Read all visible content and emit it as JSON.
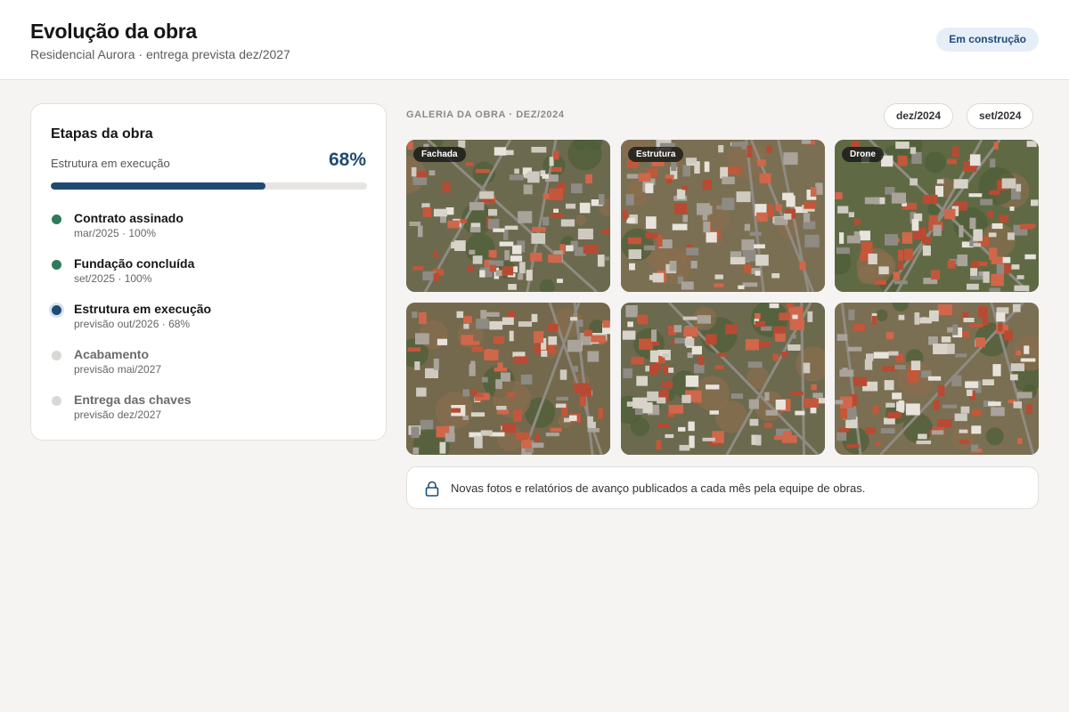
{
  "header": {
    "title": "Evolução da obra",
    "subtitle": "Residencial Aurora · entrega prevista dez/2027",
    "status": "Em construção"
  },
  "progress_card": {
    "title": "Etapas da obra",
    "current_stage": "Estrutura em execução",
    "percent_label": "68%",
    "progress": 0.68,
    "stages": [
      {
        "name": "Contrato assinado",
        "meta": "mar/2025 · 100%",
        "state": "done"
      },
      {
        "name": "Fundação concluída",
        "meta": "set/2025 · 100%",
        "state": "done"
      },
      {
        "name": "Estrutura em execução",
        "meta": "previsão out/2026 · 68%",
        "state": "current"
      },
      {
        "name": "Acabamento",
        "meta": "previsão mai/2027",
        "state": "pending"
      },
      {
        "name": "Entrega das chaves",
        "meta": "previsão dez/2027",
        "state": "pending"
      }
    ]
  },
  "gallery": {
    "label": "GALERIA DA OBRA · DEZ/2024",
    "months": [
      "dez/2024",
      "set/2024"
    ],
    "photos": [
      {
        "tag": "Fachada"
      },
      {
        "tag": "Estrutura"
      },
      {
        "tag": "Drone"
      },
      {
        "tag": ""
      },
      {
        "tag": ""
      },
      {
        "tag": ""
      }
    ]
  },
  "notice": {
    "icon": "lock-icon",
    "text": "Novas fotos e relatórios de avanço publicados a cada mês pela equipe de obras."
  },
  "colors": {
    "accent": "#1f4b73",
    "done": "#2f7a5c",
    "pending": "#d9d8d4",
    "badge_bg": "#e6eef8"
  }
}
